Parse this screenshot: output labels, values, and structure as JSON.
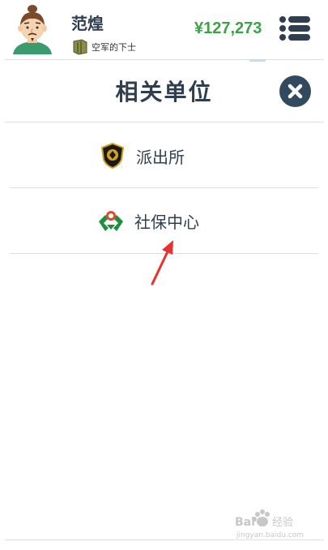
{
  "header": {
    "username": "范煌",
    "rank_text": "空军的下士",
    "balance": "¥127,273"
  },
  "panel": {
    "title": "相关单位",
    "items": [
      {
        "label": "派出所",
        "icon": "police-badge-icon"
      },
      {
        "label": "社保中心",
        "icon": "social-security-logo-icon"
      }
    ]
  },
  "colors": {
    "balance": "#3aa346",
    "text": "#2f3f4f",
    "close_button": "#324a5f",
    "arrow": "#e8322f"
  }
}
